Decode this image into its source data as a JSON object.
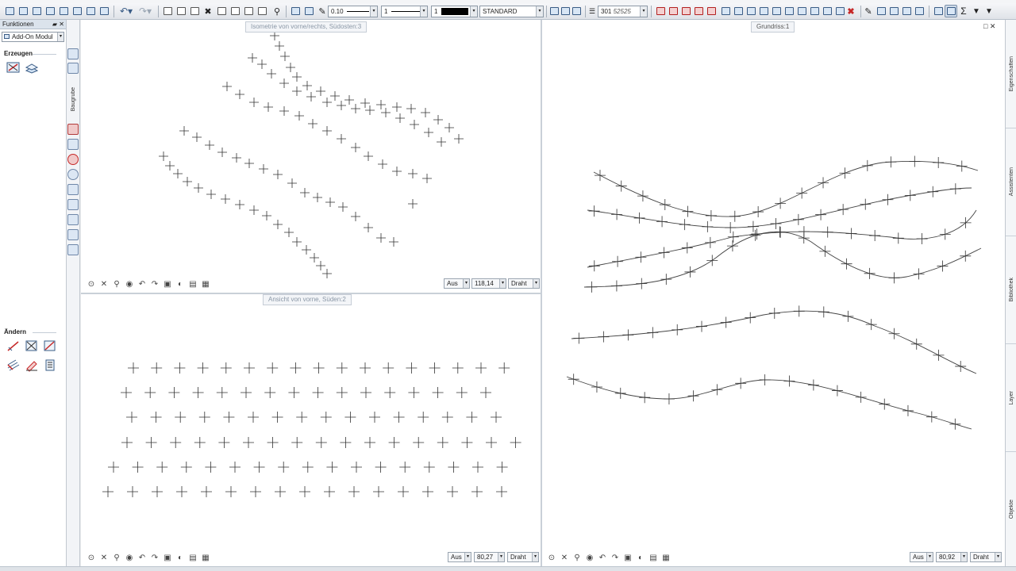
{
  "toolbar": {
    "line_width_value": "0.10",
    "line_type_value": "1",
    "pen_color_value": "1",
    "format_value": "STANDARD",
    "layer_value": "301",
    "layer_suffix": "52525"
  },
  "left_panel": {
    "title": "Funktionen",
    "pin_label": "✕",
    "module_combo": "Add-On Modul",
    "section_create": "Erzeugen",
    "section_modify": "Ändern",
    "vertical_tab": "Baugrube"
  },
  "views": {
    "iso": {
      "title": "Isometrie von vorne/rechts, Südosten:3",
      "mode": "Aus",
      "zoom": "118,14",
      "display": "Draht"
    },
    "front": {
      "title": "Ansicht von vorne, Süden:2",
      "mode": "Aus",
      "zoom": "80,27",
      "display": "Draht"
    },
    "plan": {
      "title": "Grundriss:1",
      "mode": "Aus",
      "zoom": "80,92",
      "display": "Draht"
    }
  },
  "right_tabs": [
    "Eigenschaften",
    "Assistenten",
    "Bibliothek",
    "Layer",
    "Objekte"
  ],
  "icons": {
    "toolbar": [
      "new-icon",
      "open-icon",
      "save-icon",
      "print-icon",
      "undo-icon",
      "redo-icon",
      "cut-icon",
      "copy-icon",
      "paste-icon",
      "delete-icon",
      "zoom-icon",
      "pen-icon",
      "eraser-icon",
      "filter-icon",
      "sum-icon"
    ],
    "view_bar": [
      "select-icon",
      "cross-icon",
      "zoom-in-icon",
      "pan-icon",
      "undo-view-icon",
      "redo-view-icon",
      "window-icon",
      "eye-icon",
      "layers-icon",
      "grid-icon"
    ]
  },
  "colors": {
    "accent": "#3a5c86",
    "red_tool": "#c62828",
    "pen_black": "#000000",
    "line": "#333333"
  }
}
